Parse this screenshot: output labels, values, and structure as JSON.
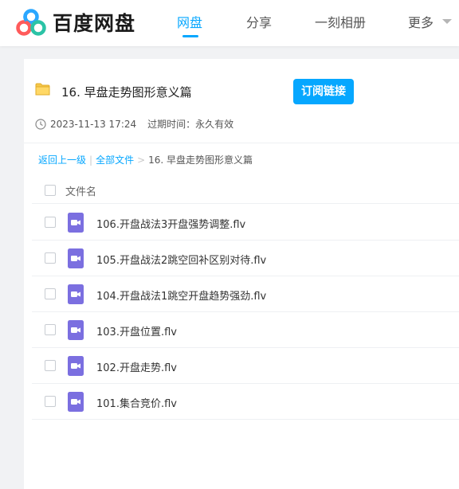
{
  "header": {
    "logo_text": "百度网盘",
    "nav": [
      {
        "label": "网盘",
        "active": true
      },
      {
        "label": "分享",
        "active": false
      },
      {
        "label": "一刻相册",
        "active": false
      },
      {
        "label": "更多",
        "active": false
      }
    ],
    "accent_color": "#06a7ff"
  },
  "share": {
    "title": "16. 早盘走势图形意义篇",
    "subscribe_label": "订阅链接",
    "created": "2023-11-13 17:24",
    "expire_label": "过期时间：永久有效"
  },
  "breadcrumb": {
    "back": "返回上一级",
    "divider": "|",
    "all_files": "全部文件",
    "arrow": ">",
    "current": "16. 早盘走势图形意义篇"
  },
  "list": {
    "column_name": "文件名",
    "files": [
      {
        "name": "106.开盘战法3开盘强势调整.flv",
        "icon": "video-file-icon"
      },
      {
        "name": "105.开盘战法2跳空回补区别对待.flv",
        "icon": "video-file-icon"
      },
      {
        "name": "104.开盘战法1跳空开盘趋势强劲.flv",
        "icon": "video-file-icon"
      },
      {
        "name": "103.开盘位置.flv",
        "icon": "video-file-icon"
      },
      {
        "name": "102.开盘走势.flv",
        "icon": "video-file-icon"
      },
      {
        "name": "101.集合竞价.flv",
        "icon": "video-file-icon"
      }
    ]
  }
}
